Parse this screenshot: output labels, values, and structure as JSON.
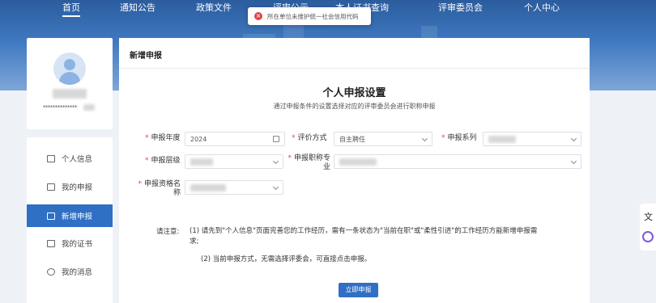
{
  "nav": {
    "items": [
      "首页",
      "通知公告",
      "政策文件",
      "评审公示",
      "本人证书查询",
      "评审委员会",
      "个人中心"
    ],
    "active_index": 0
  },
  "toast": {
    "message": "所在单位未维护统一社会信用代码"
  },
  "profile": {
    "masked_id": "**************"
  },
  "sidebar": {
    "items": [
      {
        "label": "个人信息",
        "icon": "id-card-icon"
      },
      {
        "label": "我的申报",
        "icon": "document-icon"
      },
      {
        "label": "新增申报",
        "icon": "edit-icon"
      },
      {
        "label": "我的证书",
        "icon": "certificate-icon"
      },
      {
        "label": "我的消息",
        "icon": "message-icon"
      }
    ],
    "active_index": 2
  },
  "panel": {
    "header": "新增申报",
    "title": "个人申报设置",
    "subtitle": "通过申报条件的设置选择对应的评审委员会进行职称申报"
  },
  "form": {
    "year_label": "申报年度",
    "year_value": "2024",
    "method_label": "评价方式",
    "method_value": "自主聘任",
    "series_label": "申报系列",
    "level_label": "申报层级",
    "major_label": "申报职称专业",
    "qualification_label": "申报资格名称"
  },
  "notice": {
    "label": "请注意:",
    "item1": "(1) 请先到\"个人信息\"页面完善您的工作经历，需有一条状态为\"当前在职\"或\"柔性引进\"的工作经历方能新增申报需求;",
    "item2": "(2) 当前申报方式，无需选择评委会，可直接点击申报。"
  },
  "apply_button": "立即申报",
  "floating_tool": {
    "glyph": "文"
  },
  "colors": {
    "primary": "#2f6fc4",
    "error": "#e0454a",
    "banner": "#3f78c0"
  }
}
